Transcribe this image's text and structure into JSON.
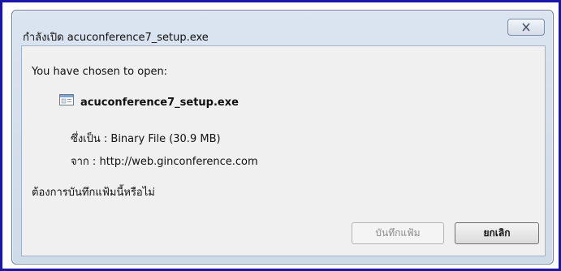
{
  "window": {
    "title": "กำลังเปิด acuconference7_setup.exe",
    "close_icon": "close-x-icon"
  },
  "dialog": {
    "intro": "You have chosen to open:",
    "file_icon": "file-icon",
    "file_name": "acuconference7_setup.exe",
    "type_label": "ซึ่งเป็น :",
    "type_value": "Binary File (30.9 MB)",
    "from_label": "จาก :",
    "from_value": "http://web.ginconference.com",
    "question": "ต้องการบันทึกแฟ้มนี้หรือไม่"
  },
  "buttons": {
    "save": "บันทึกแฟ้ม",
    "cancel": "ยกเลิก"
  },
  "colors": {
    "frame": "#1a17a6",
    "titlebar": "#d6e0ee",
    "content_bg": "#f0f0f0"
  }
}
